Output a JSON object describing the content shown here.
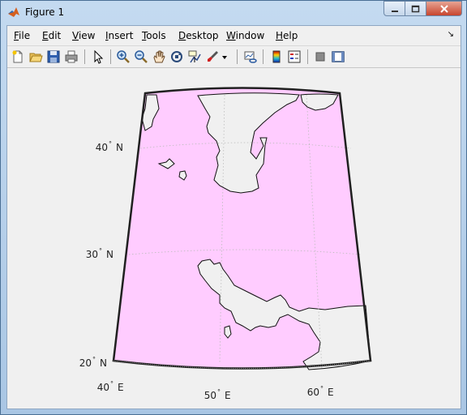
{
  "window": {
    "title": "Figure 1"
  },
  "menu": {
    "items": [
      {
        "pre": "",
        "u": "F",
        "post": "ile"
      },
      {
        "pre": "",
        "u": "E",
        "post": "dit"
      },
      {
        "pre": "",
        "u": "V",
        "post": "iew"
      },
      {
        "pre": "",
        "u": "I",
        "post": "nsert"
      },
      {
        "pre": "",
        "u": "T",
        "post": "ools"
      },
      {
        "pre": "",
        "u": "D",
        "post": "esktop"
      },
      {
        "pre": "",
        "u": "W",
        "post": "indow"
      },
      {
        "pre": "",
        "u": "H",
        "post": "elp"
      }
    ]
  },
  "toolbar": {
    "icons": [
      "new-figure-icon",
      "open-file-icon",
      "save-icon",
      "print-icon",
      "edit-plot-icon",
      "zoom-in-icon",
      "zoom-out-icon",
      "pan-icon",
      "rotate-3d-icon",
      "data-cursor-icon",
      "brush-icon",
      "link-plot-icon",
      "colorbar-icon",
      "legend-icon",
      "hide-plot-tools-icon",
      "show-plot-tools-icon"
    ]
  },
  "map": {
    "projection": "Lambert conformal conic",
    "land_color": "#f0f0f0",
    "water_color": "#ffccff",
    "frame_color": "#202020",
    "grid": "dotted",
    "latitude_labels": [
      {
        "deg": "40",
        "hemi": "N"
      },
      {
        "deg": "30",
        "hemi": "N"
      },
      {
        "deg": "20",
        "hemi": "N"
      }
    ],
    "longitude_labels": [
      {
        "deg": "40",
        "hemi": "E"
      },
      {
        "deg": "50",
        "hemi": "E"
      },
      {
        "deg": "60",
        "hemi": "E"
      }
    ],
    "degree_symbol": "°"
  }
}
